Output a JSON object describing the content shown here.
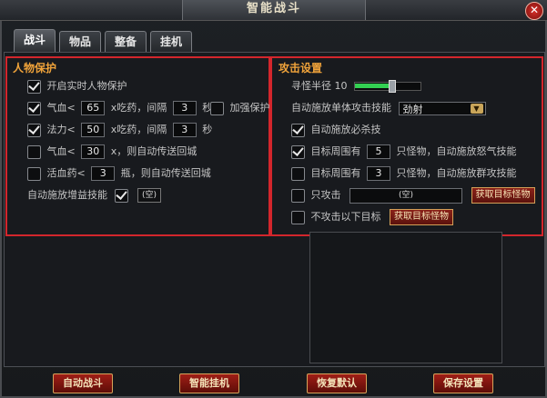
{
  "window": {
    "title": "智能战斗",
    "close_icon": "close-icon"
  },
  "tabs": [
    {
      "label": "战斗",
      "active": true
    },
    {
      "label": "物品",
      "active": false
    },
    {
      "label": "整备",
      "active": false
    },
    {
      "label": "挂机",
      "active": false
    }
  ],
  "character_protection": {
    "title": "人物保护",
    "realtime": {
      "checked": true,
      "label": "开启实时人物保护"
    },
    "hp": {
      "checked": true,
      "label": "气血<",
      "value": "65",
      "middle": "x吃药，间隔",
      "interval": "3",
      "unit": "秒"
    },
    "strengthen": {
      "checked": false,
      "label": "加强保护"
    },
    "mp": {
      "checked": true,
      "label": "法力<",
      "value": "50",
      "middle": "x吃药，间隔",
      "interval": "3",
      "unit": "秒"
    },
    "hp_return": {
      "checked": false,
      "label": "气血<",
      "value": "30",
      "suffix": "x，则自动传送回城"
    },
    "potion_return": {
      "checked": false,
      "label": "活血药<",
      "value": "3",
      "suffix": "瓶，则自动传送回城"
    },
    "buff_skill": {
      "label": "自动施放增益技能",
      "checked": true,
      "value": "(空)"
    }
  },
  "attack_settings": {
    "title": "攻击设置",
    "search_radius": {
      "label": "寻怪半径",
      "value": "10",
      "fill": 0.55
    },
    "single_skill": {
      "label": "自动施放单体攻击技能",
      "value": "劲射"
    },
    "ultimate": {
      "checked": true,
      "label": "自动施放必杀技"
    },
    "surround_rage": {
      "checked": true,
      "prefix": "目标周围有",
      "value": "5",
      "suffix": "只怪物，自动施放怒气技能"
    },
    "surround_group": {
      "checked": false,
      "prefix": "目标周围有",
      "value": "3",
      "suffix": "只怪物，自动施放群攻技能"
    },
    "only_attack": {
      "checked": false,
      "label": "只攻击",
      "value": "(空)",
      "button": "获取目标怪物"
    },
    "not_attack": {
      "checked": false,
      "label": "不攻击以下目标",
      "button": "获取目标怪物"
    }
  },
  "bottom": {
    "auto_fight": "自动战斗",
    "smart_hangup": "智能挂机",
    "restore_default": "恢复默认",
    "save_settings": "保存设置"
  }
}
